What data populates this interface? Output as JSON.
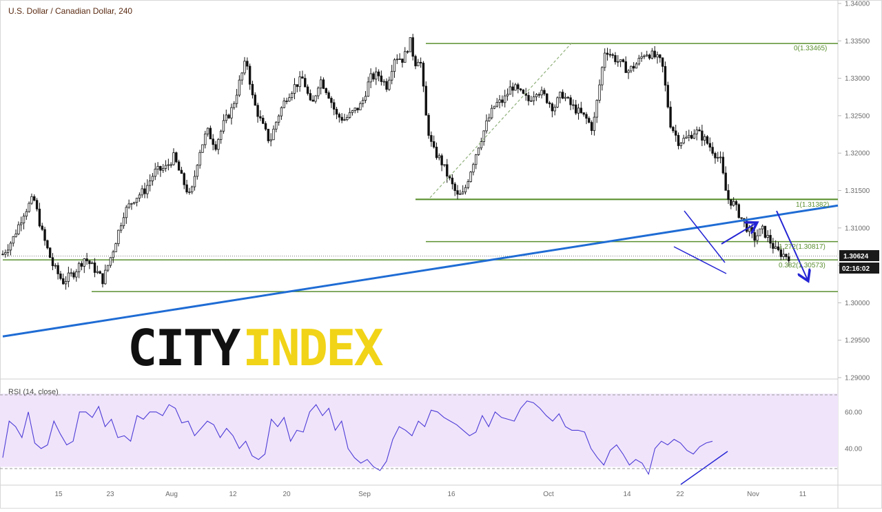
{
  "chart_data": [
    {
      "type": "candlestick",
      "title": "U.S. Dollar / Canadian Dollar, 240",
      "ylim": [
        1.29,
        1.34
      ],
      "y_ticks": [
        "1.34000",
        "1.33500",
        "1.33000",
        "1.32500",
        "1.32000",
        "1.31500",
        "1.31000",
        "1.30500",
        "1.30000",
        "1.29500",
        "1.29000"
      ],
      "x_ticks": [
        "15",
        "23",
        "Aug",
        "12",
        "20",
        "Sep",
        "16",
        "Oct",
        "14",
        "22",
        "Nov",
        "11"
      ],
      "grid": false,
      "price_path": [
        [
          0,
          1.3065
        ],
        [
          0.012,
          1.3085
        ],
        [
          0.025,
          1.312
        ],
        [
          0.037,
          1.314
        ],
        [
          0.048,
          1.309
        ],
        [
          0.06,
          1.305
        ],
        [
          0.072,
          1.3028
        ],
        [
          0.085,
          1.304
        ],
        [
          0.098,
          1.306
        ],
        [
          0.11,
          1.3045
        ],
        [
          0.12,
          1.303
        ],
        [
          0.132,
          1.307
        ],
        [
          0.145,
          1.312
        ],
        [
          0.158,
          1.314
        ],
        [
          0.17,
          1.315
        ],
        [
          0.182,
          1.3175
        ],
        [
          0.195,
          1.318
        ],
        [
          0.205,
          1.3195
        ],
        [
          0.215,
          1.3165
        ],
        [
          0.225,
          1.314
        ],
        [
          0.235,
          1.32
        ],
        [
          0.245,
          1.323
        ],
        [
          0.255,
          1.321
        ],
        [
          0.265,
          1.324
        ],
        [
          0.275,
          1.326
        ],
        [
          0.285,
          1.33
        ],
        [
          0.292,
          1.3325
        ],
        [
          0.3,
          1.327
        ],
        [
          0.31,
          1.324
        ],
        [
          0.32,
          1.3215
        ],
        [
          0.33,
          1.325
        ],
        [
          0.34,
          1.3275
        ],
        [
          0.35,
          1.329
        ],
        [
          0.36,
          1.33
        ],
        [
          0.37,
          1.326
        ],
        [
          0.38,
          1.33
        ],
        [
          0.39,
          1.328
        ],
        [
          0.4,
          1.325
        ],
        [
          0.41,
          1.3245
        ],
        [
          0.42,
          1.3255
        ],
        [
          0.43,
          1.3265
        ],
        [
          0.44,
          1.33
        ],
        [
          0.45,
          1.3305
        ],
        [
          0.46,
          1.329
        ],
        [
          0.47,
          1.333
        ],
        [
          0.48,
          1.3325
        ],
        [
          0.488,
          1.335
        ],
        [
          0.494,
          1.332
        ],
        [
          0.5,
          1.333
        ],
        [
          0.508,
          1.324
        ],
        [
          0.515,
          1.3205
        ],
        [
          0.525,
          1.319
        ],
        [
          0.535,
          1.3165
        ],
        [
          0.545,
          1.3142
        ],
        [
          0.552,
          1.3145
        ],
        [
          0.56,
          1.3175
        ],
        [
          0.57,
          1.321
        ],
        [
          0.58,
          1.324
        ],
        [
          0.59,
          1.3265
        ],
        [
          0.6,
          1.327
        ],
        [
          0.61,
          1.329
        ],
        [
          0.62,
          1.328
        ],
        [
          0.63,
          1.327
        ],
        [
          0.64,
          1.3285
        ],
        [
          0.65,
          1.3275
        ],
        [
          0.66,
          1.326
        ],
        [
          0.67,
          1.328
        ],
        [
          0.68,
          1.3265
        ],
        [
          0.69,
          1.3255
        ],
        [
          0.7,
          1.3245
        ],
        [
          0.707,
          1.3232
        ],
        [
          0.715,
          1.329
        ],
        [
          0.722,
          1.334
        ],
        [
          0.73,
          1.333
        ],
        [
          0.74,
          1.332
        ],
        [
          0.75,
          1.331
        ],
        [
          0.76,
          1.332
        ],
        [
          0.77,
          1.3335
        ],
        [
          0.78,
          1.333
        ],
        [
          0.79,
          1.332
        ],
        [
          0.8,
          1.324
        ],
        [
          0.81,
          1.3215
        ],
        [
          0.82,
          1.322
        ],
        [
          0.83,
          1.323
        ],
        [
          0.84,
          1.322
        ],
        [
          0.85,
          1.3205
        ],
        [
          0.86,
          1.319
        ],
        [
          0.868,
          1.314
        ],
        [
          0.876,
          1.3132
        ],
        [
          0.884,
          1.3115
        ],
        [
          0.892,
          1.31
        ],
        [
          0.9,
          1.3085
        ],
        [
          0.91,
          1.3098
        ],
        [
          0.918,
          1.3085
        ],
        [
          0.926,
          1.307
        ],
        [
          0.934,
          1.3065
        ],
        [
          0.942,
          1.3062
        ]
      ],
      "annotations": {
        "fib_labels": [
          "0(1.33465)",
          "1(1.31382)",
          "1.272(1.30817)",
          "0.382(1.30573)"
        ],
        "current_price": "1.30624",
        "countdown": "02:16:02"
      },
      "horizontal_levels": [
        1.33465,
        1.31382,
        1.30817,
        1.30573,
        1.3015
      ],
      "trendline": {
        "from_price": 1.2955,
        "to_price": 1.313
      },
      "colors": {
        "candles": "#111111",
        "fib_lines": "#5a8f2f",
        "trendline": "#1f6cd4",
        "arrows": "#2424d4",
        "price_box": "#1a1a1a"
      }
    },
    {
      "type": "line",
      "title": "RSI (14, close)",
      "ylim": [
        20,
        75
      ],
      "y_ticks": [
        "60.00",
        "40.00"
      ],
      "band": [
        30,
        70
      ],
      "band_color": "#f0e4fb",
      "line_color": "#4d3cd6",
      "values": [
        35,
        55,
        52,
        46,
        60,
        43,
        40,
        42,
        55,
        48,
        42,
        44,
        60,
        60,
        57,
        63,
        52,
        56,
        46,
        47,
        44,
        58,
        56,
        60,
        60,
        58,
        64,
        62,
        54,
        55,
        47,
        51,
        55,
        53,
        46,
        51,
        47,
        40,
        44,
        36,
        34,
        37,
        56,
        52,
        57,
        44,
        50,
        49,
        60,
        64,
        58,
        62,
        50,
        55,
        40,
        35,
        32,
        34,
        30,
        28,
        33,
        45,
        52,
        50,
        47,
        55,
        52,
        61,
        60,
        57,
        55,
        53,
        50,
        47,
        49,
        58,
        52,
        60,
        57,
        56,
        55,
        62,
        66,
        65,
        62,
        58,
        55,
        59,
        52,
        50,
        50,
        49,
        40,
        35,
        31,
        39,
        42,
        37,
        31,
        34,
        32,
        26,
        40,
        44,
        42,
        45,
        43,
        39,
        37,
        41,
        43,
        44
      ]
    }
  ],
  "logo": {
    "part1": "CITY",
    "part2": "INDEX"
  }
}
